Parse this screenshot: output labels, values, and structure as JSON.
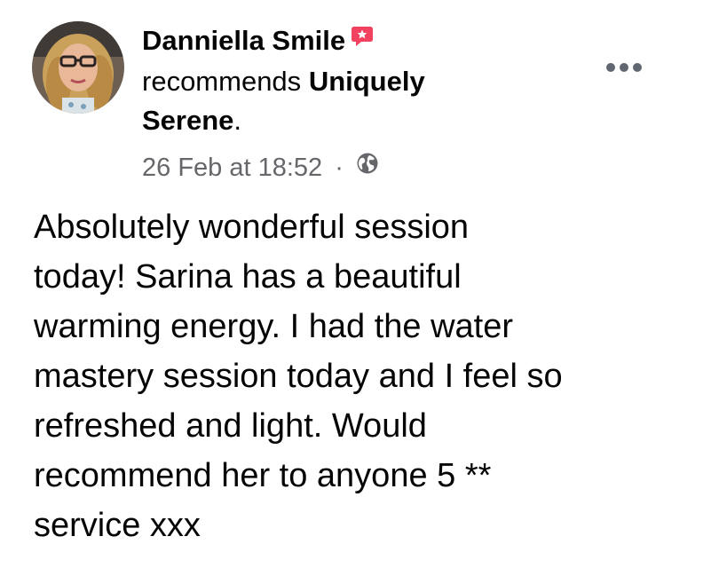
{
  "post": {
    "author": "Danniella Smile",
    "recommends_prefix": "recommends",
    "page_name": "Uniquely Serene",
    "page_suffix": ".",
    "timestamp": "26 Feb at 18:52",
    "separator": "·",
    "privacy_icon": "globe-icon",
    "more_icon": "more-options-icon",
    "badge_icon": "recommendation-badge-icon",
    "text_lines": [
      "Absolutely wonderful session",
      "today! Sarina has a beautiful",
      "warming energy. I had the water",
      "mastery session today and I feel so",
      "refreshed and light. Would",
      "recommend her to anyone 5 **",
      "service xxx"
    ]
  },
  "colors": {
    "badge": "#f3425f",
    "meta_text": "#65676b",
    "body_text": "#050505"
  }
}
